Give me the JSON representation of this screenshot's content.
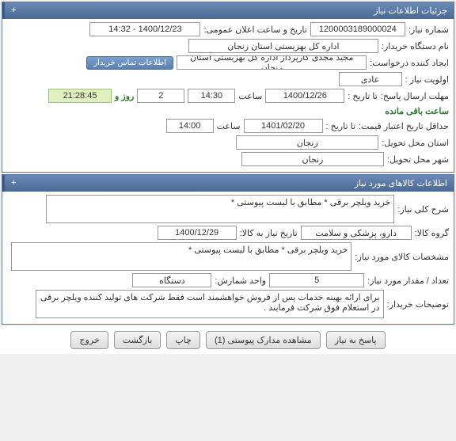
{
  "sections": {
    "details_title": "جزئیات اطلاعات نیاز",
    "items_title": "اطلاعات کالاهای مورد نیاز",
    "expand": "+"
  },
  "labels": {
    "need_number": "شماره نیاز:",
    "announce_date": "تاریخ و ساعت اعلان عمومی:",
    "buyer_org": "نام دستگاه خریدار:",
    "requester": "ایجاد کننده درخواست:",
    "contact_btn": "اطلاعات تماس خریدار",
    "priority": "اولویت نیاز :",
    "response_deadline": "مهلت ارسال پاسخ:",
    "to_date": "تا تاریخ :",
    "time": "ساعت",
    "days_and": "روز و",
    "remaining": "ساعت باقی مانده",
    "price_validity": "حداقل تاریخ اعتبار قیمت:",
    "delivery_province": "استان محل تحویل:",
    "delivery_city": "شهر محل تحویل:",
    "need_desc": "شرح کلی نیاز:",
    "goods_group": "گروه کالا:",
    "need_by_date": "تاریخ نیاز به کالا:",
    "item_spec": "مشخصات کالای مورد نیاز:",
    "qty": "تعداد / مقدار مورد نیاز:",
    "unit": "واحد شمارش:",
    "buyer_notes": "توضیحات خریدار:"
  },
  "values": {
    "need_number": "1200003189000024",
    "announce_date": "1400/12/23 - 14:32",
    "buyer_org": "اداره کل بهزیستی استان زنجان",
    "requester": "مجید مجدی کارپرداز اداره کل بهزیستی استان زنجان",
    "priority": "عادی",
    "resp_date": "1400/12/26",
    "resp_time": "14:30",
    "days_remaining": "2",
    "hours_remaining": "21:28:45",
    "val_date": "1401/02/20",
    "val_time": "14:00",
    "province": "زنجان",
    "city": "زنجان",
    "need_desc": "خرید ویلچر برقی * مطابق با لیست پیوستی *",
    "goods_group": "دارو، پزشکی و سلامت",
    "need_by_date": "1400/12/29",
    "item_spec": "خرید ویلچر برقی * مطابق با لیست پیوستی *",
    "qty": "5",
    "unit": "دستگاه",
    "buyer_notes": "برای ارائه بهینه خدمات پس از فروش خواهشمند است فقط شرکت های تولید کننده ویلچر برقی در استعلام فوق شرکت فرمایند ."
  },
  "buttons": {
    "respond": "پاسخ به نیاز",
    "attachments": "مشاهده مدارک پیوستی (1)",
    "print": "چاپ",
    "back": "بازگشت",
    "exit": "خروج"
  }
}
